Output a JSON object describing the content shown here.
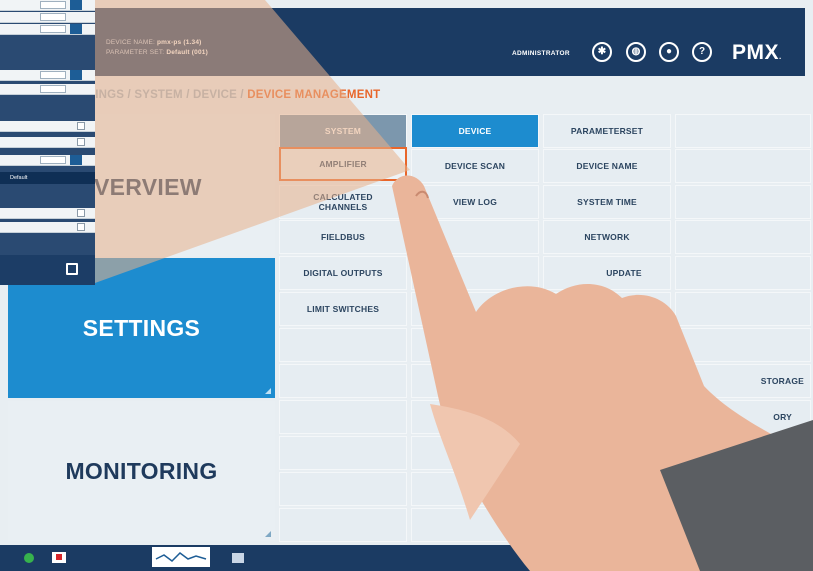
{
  "header": {
    "device_name_label": "DEVICE NAME:",
    "device_name_value": "pmx-ps (1.34)",
    "parameter_set_label": "PARAMETER SET:",
    "parameter_set_value": "Default (001)",
    "user": "ADMINISTRATOR",
    "icons": [
      "settings-gear-icon",
      "globe-icon",
      "record-icon",
      "help-icon"
    ],
    "logo": "PMX",
    "logo_suffix": "."
  },
  "breadcrumb": {
    "path": "TINGS / SYSTEM / DEVICE / ",
    "current": "DEVICE MANAGEMENT"
  },
  "nav": {
    "overview": "VERVIEW",
    "settings": "SETTINGS",
    "monitoring": "MONITORING"
  },
  "grid": {
    "col1": [
      "SYSTEM",
      "AMPLIFIER",
      "CALCULATED\nCHANNELS",
      "FIELDBUS",
      "DIGITAL OUTPUTS",
      "LIMIT SWITCHES"
    ],
    "col2": [
      "DEVICE",
      "DEVICE SCAN",
      "VIEW LOG"
    ],
    "col3": [
      "PARAMETERSET",
      "DEVICE NAME",
      "SYSTEM TIME",
      "NETWORK",
      "UPDATE"
    ],
    "col4": [
      "STORAGE",
      "ORY"
    ]
  },
  "panel": {
    "highlight": "Default"
  },
  "colors": {
    "header": "#1b3b63",
    "accent_blue": "#1d8ccf",
    "accent_orange": "#e8662b"
  }
}
